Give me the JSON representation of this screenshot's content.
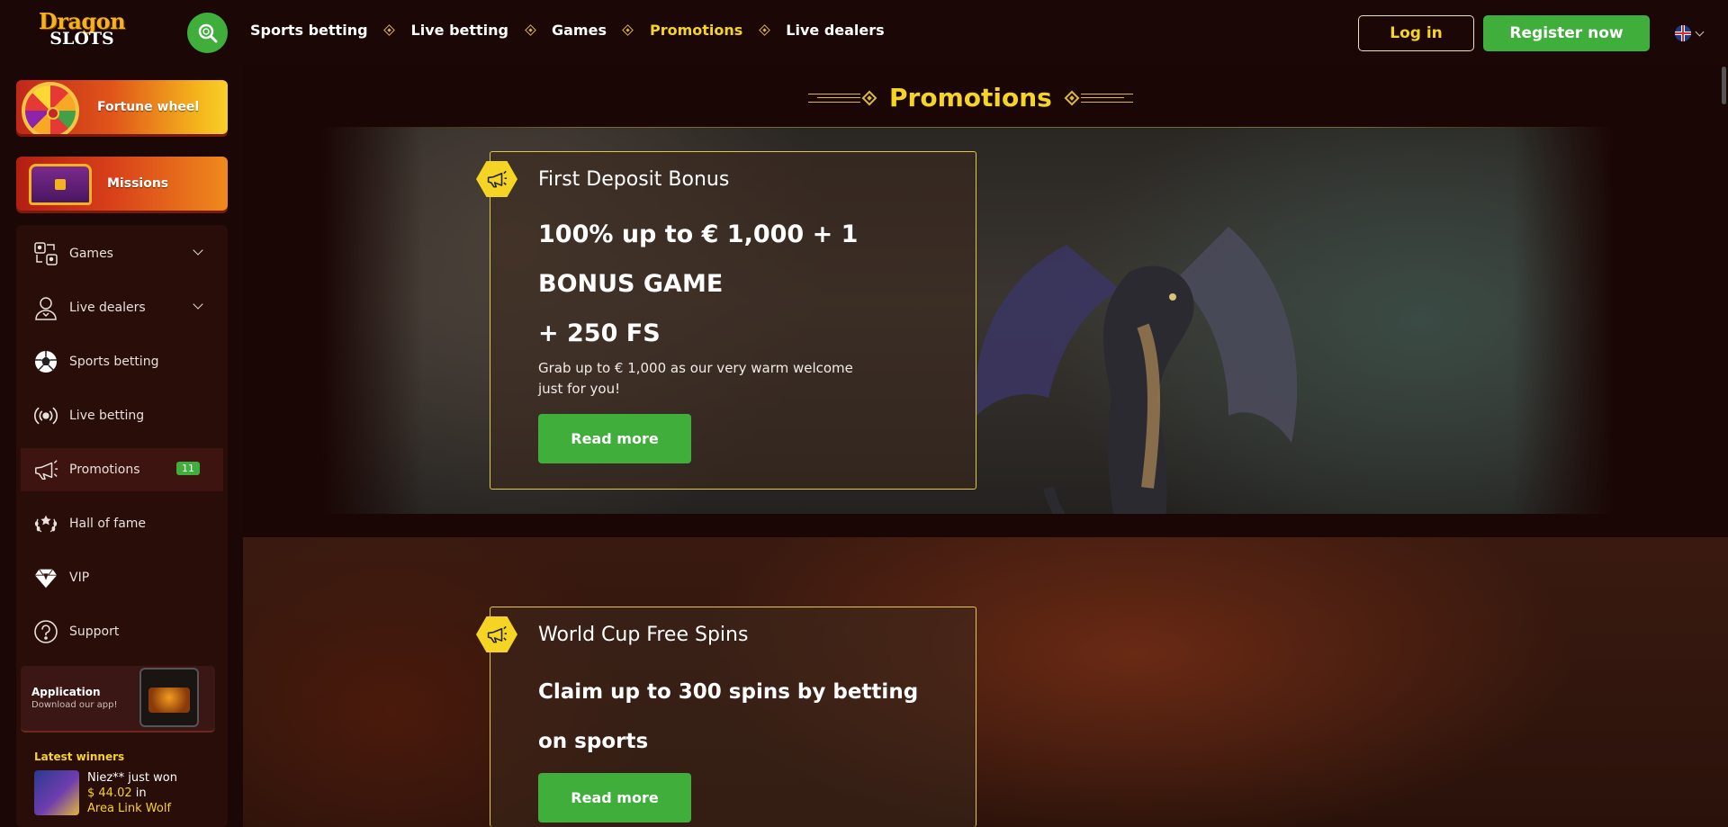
{
  "brand": {
    "line1": "Dragon",
    "line2": "SLOTS"
  },
  "header": {
    "nav": [
      "Sports betting",
      "Live betting",
      "Games",
      "Promotions",
      "Live dealers"
    ],
    "active_nav": "Promotions",
    "login": "Log in",
    "register": "Register now"
  },
  "colors": {
    "accent_yellow": "#f5d423",
    "button_green": "#3fae3a",
    "background": "#1a0604"
  },
  "sidebar": {
    "fortune_wheel": "Fortune wheel",
    "missions": "Missions",
    "items": [
      {
        "label": "Games",
        "icon": "games-icon"
      },
      {
        "label": "Live dealers",
        "icon": "dealer-icon"
      },
      {
        "label": "Sports betting",
        "icon": "soccer-ball-icon"
      },
      {
        "label": "Live betting",
        "icon": "broadcast-icon"
      },
      {
        "label": "Promotions",
        "icon": "megaphone-icon",
        "badge": "11"
      },
      {
        "label": "Hall of fame",
        "icon": "laurel-icon"
      },
      {
        "label": "VIP",
        "icon": "diamond-icon"
      },
      {
        "label": "Support",
        "icon": "question-icon"
      }
    ],
    "app": {
      "title": "Application",
      "subtitle": "Download our app!"
    },
    "winners": {
      "title": "Latest winners",
      "entry": {
        "name": "Niez** just won",
        "amount": "$ 44.02",
        "in": "in",
        "game": "Area Link Wolf"
      }
    }
  },
  "main": {
    "title": "Promotions",
    "promos": [
      {
        "title": "First Deposit Bonus",
        "lines": [
          "100% up to € 1,000 + 1",
          "BONUS GAME",
          "+ 250 FS"
        ],
        "description": "Grab up to € 1,000 as our very warm welcome just for you!",
        "button": "Read more"
      },
      {
        "title": "World Cup Free Spins",
        "lines": [
          "Claim up to 300 spins by betting",
          "on sports"
        ],
        "button": "Read more"
      }
    ]
  }
}
